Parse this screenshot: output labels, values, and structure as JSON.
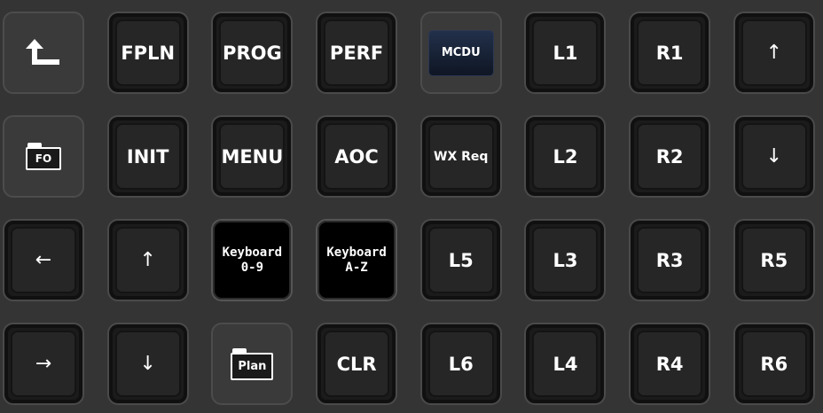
{
  "keys": [
    {
      "id": "back",
      "label": "",
      "icon": "back-up-arrow-icon"
    },
    {
      "id": "fpln",
      "label": "FPLN"
    },
    {
      "id": "prog",
      "label": "PROG"
    },
    {
      "id": "perf",
      "label": "PERF"
    },
    {
      "id": "mcdu",
      "label": "MCDU"
    },
    {
      "id": "l1",
      "label": "L1"
    },
    {
      "id": "r1",
      "label": "R1"
    },
    {
      "id": "up-arrow-1",
      "label": "↑"
    },
    {
      "id": "fo-folder",
      "label": "FO",
      "icon": "folder-icon"
    },
    {
      "id": "init",
      "label": "INIT"
    },
    {
      "id": "menu",
      "label": "MENU"
    },
    {
      "id": "aoc",
      "label": "AOC"
    },
    {
      "id": "wx-req",
      "label": "WX Req"
    },
    {
      "id": "l2",
      "label": "L2"
    },
    {
      "id": "r2",
      "label": "R2"
    },
    {
      "id": "down-arrow-1",
      "label": "↓"
    },
    {
      "id": "left-arrow",
      "label": "←"
    },
    {
      "id": "up-arrow-2",
      "label": "↑"
    },
    {
      "id": "keyboard-0-9",
      "label": "Keyboard\n0-9"
    },
    {
      "id": "keyboard-a-z",
      "label": "Keyboard\nA-Z"
    },
    {
      "id": "l5",
      "label": "L5"
    },
    {
      "id": "l3",
      "label": "L3"
    },
    {
      "id": "r3",
      "label": "R3"
    },
    {
      "id": "r5",
      "label": "R5"
    },
    {
      "id": "right-arrow",
      "label": "→"
    },
    {
      "id": "down-arrow-2",
      "label": "↓"
    },
    {
      "id": "plan-folder",
      "label": "Plan",
      "icon": "folder-icon"
    },
    {
      "id": "clr",
      "label": "CLR"
    },
    {
      "id": "l6",
      "label": "L6"
    },
    {
      "id": "l4",
      "label": "L4"
    },
    {
      "id": "r4",
      "label": "R4"
    },
    {
      "id": "r6",
      "label": "R6"
    }
  ]
}
